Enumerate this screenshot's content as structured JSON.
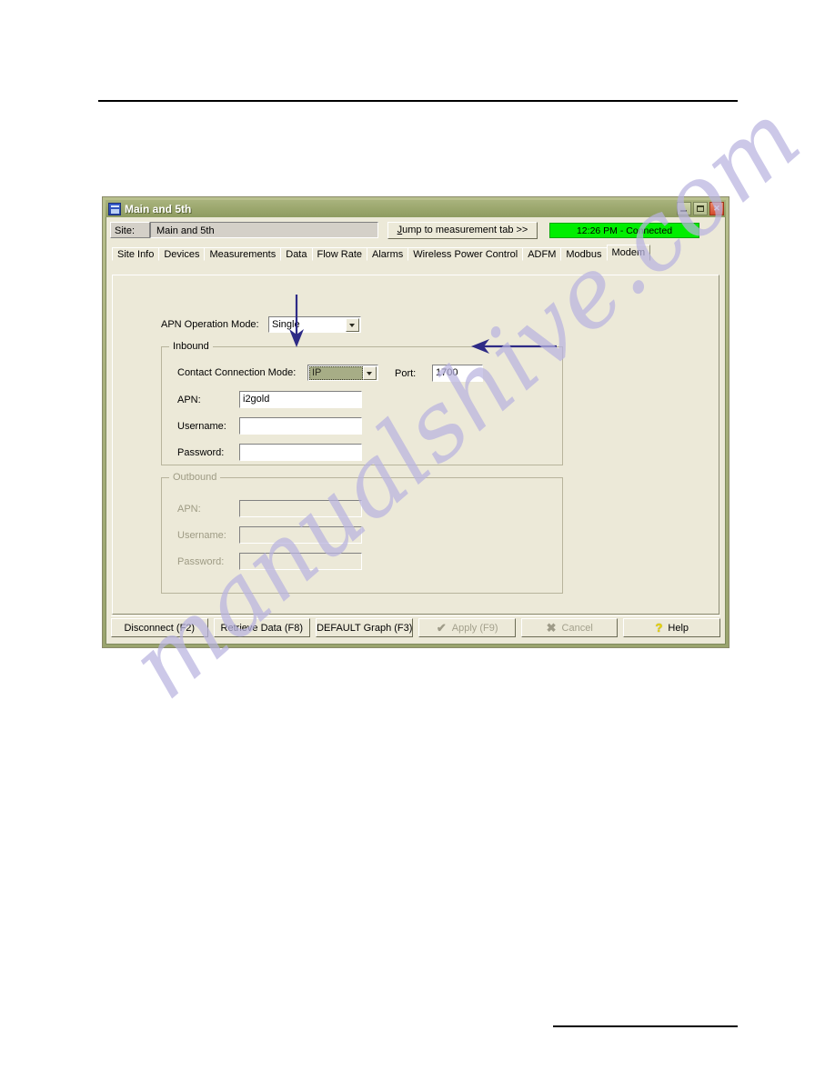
{
  "document": {
    "watermark": "manualshive.com"
  },
  "window": {
    "title": "Main and 5th",
    "controls": {
      "minimize": "minimize-button",
      "maximize": "maximize-button",
      "close": "close-button"
    }
  },
  "header": {
    "site_label": "Site:",
    "site_value": "Main and 5th",
    "jump_button_prefix": "J",
    "jump_button_rest": "ump to measurement tab >>",
    "status": "12:26 PM - Connected",
    "status_color": "#00ee00"
  },
  "tabs": [
    {
      "label": "Site Info",
      "active": false
    },
    {
      "label": "Devices",
      "active": false
    },
    {
      "label": "Measurements",
      "active": false
    },
    {
      "label": "Data",
      "active": false
    },
    {
      "label": "Flow Rate",
      "active": false
    },
    {
      "label": "Alarms",
      "active": false
    },
    {
      "label": "Wireless Power Control",
      "active": false
    },
    {
      "label": "ADFM",
      "active": false
    },
    {
      "label": "Modbus",
      "active": false
    },
    {
      "label": "Modem",
      "active": true
    }
  ],
  "modem_tab": {
    "apn_operation_mode": {
      "label": "APN Operation Mode:",
      "value": "Single"
    },
    "inbound": {
      "legend": "Inbound",
      "connection_mode_label": "Contact Connection Mode:",
      "connection_mode_value": "IP",
      "port_label": "Port:",
      "port_value": "1700",
      "apn_label": "APN:",
      "apn_value": "i2gold",
      "username_label": "Username:",
      "username_value": "",
      "password_label": "Password:",
      "password_value": ""
    },
    "outbound": {
      "legend": "Outbound",
      "apn_label": "APN:",
      "apn_value": "",
      "username_label": "Username:",
      "username_value": "",
      "password_label": "Password:",
      "password_value": ""
    }
  },
  "buttons": [
    {
      "label": "Disconnect (F2)",
      "disabled": false,
      "glyph": ""
    },
    {
      "label": "Retrieve Data (F8)",
      "disabled": false,
      "glyph": ""
    },
    {
      "label": "DEFAULT Graph (F3)",
      "disabled": false,
      "glyph": ""
    },
    {
      "label": "Apply (F9)",
      "disabled": true,
      "glyph": "check"
    },
    {
      "label": "Cancel",
      "disabled": true,
      "glyph": "cross"
    },
    {
      "label": "Help",
      "disabled": false,
      "glyph": "help"
    }
  ],
  "annotations": {
    "color": "#2e2b86",
    "down_arrow_target": "contact-connection-mode-combo",
    "left_arrow_target": "port-textbox"
  }
}
